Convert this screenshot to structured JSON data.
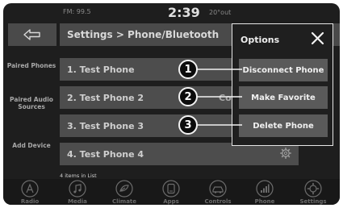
{
  "status_bar": {
    "radio": "FM: 99.5",
    "time": "2:39",
    "temp": "20°out"
  },
  "header": {
    "back_icon": "back-arrow-icon",
    "breadcrumb": "Settings > Phone/Bluetooth"
  },
  "sidebar": {
    "items": [
      {
        "label": "Paired Phones"
      },
      {
        "label": "Paired Audio Sources"
      },
      {
        "label": "Add Device"
      }
    ]
  },
  "list": {
    "items": [
      {
        "label": "1. Test Phone"
      },
      {
        "label": "2. Test Phone 2",
        "extra": "Co"
      },
      {
        "label": "3. Test Phone 3"
      },
      {
        "label": "4. Test Phone 4",
        "icon": "gear-icon"
      }
    ],
    "count_text": "4 items in List"
  },
  "options_popup": {
    "title": "Options",
    "close_icon": "close-icon",
    "buttons": [
      {
        "label": "Disconnect Phone"
      },
      {
        "label": "Make Favorite"
      },
      {
        "label": "Delete Phone"
      }
    ]
  },
  "callouts": [
    "1",
    "2",
    "3"
  ],
  "bottom_nav": {
    "items": [
      {
        "label": "Radio",
        "icon": "radio-icon"
      },
      {
        "label": "Media",
        "icon": "media-icon"
      },
      {
        "label": "Climate",
        "icon": "climate-icon"
      },
      {
        "label": "Apps",
        "icon": "apps-icon"
      },
      {
        "label": "Controls",
        "icon": "controls-icon"
      },
      {
        "label": "Phone",
        "icon": "phone-icon"
      },
      {
        "label": "Settings",
        "icon": "settings-icon"
      }
    ]
  },
  "colors": {
    "background": "#1e1e1e",
    "bar": "#4a4a4a",
    "button": "#5a5a5a",
    "text": "#e8e8e8",
    "muted_text": "#6c6c6c"
  }
}
